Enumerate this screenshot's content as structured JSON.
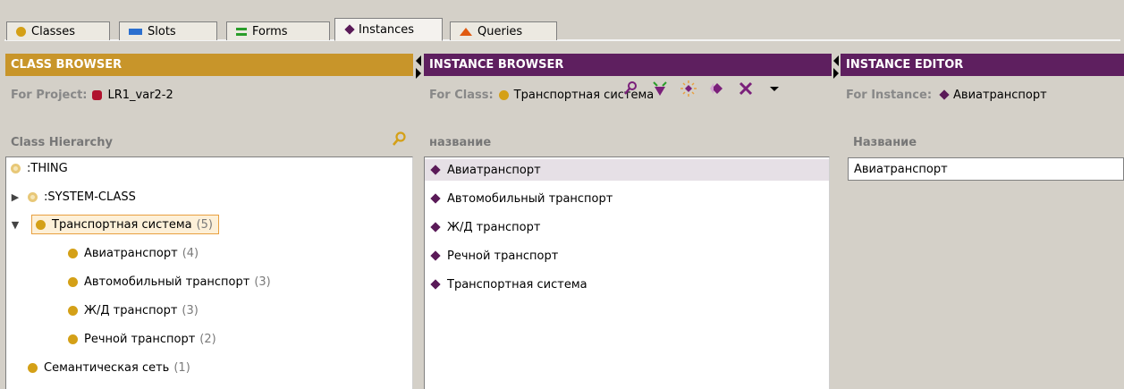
{
  "tabs": [
    {
      "label": "Classes",
      "icon": "class-dot-icon",
      "active": false
    },
    {
      "label": "Slots",
      "icon": "slot-bar-icon",
      "active": false
    },
    {
      "label": "Forms",
      "icon": "forms-icon",
      "active": false
    },
    {
      "label": "Instances",
      "icon": "instance-diamond-icon",
      "active": true
    },
    {
      "label": "Queries",
      "icon": "query-triangle-icon",
      "active": false
    }
  ],
  "class_browser": {
    "title": "CLASS BROWSER",
    "project_label": "For Project:",
    "project_name": "LR1_var2-2",
    "hierarchy_label": "Class Hierarchy",
    "tree": [
      {
        "label": ":THING",
        "count": "",
        "depth": 0,
        "toggle": "",
        "node": "ring"
      },
      {
        "label": ":SYSTEM-CLASS",
        "count": "",
        "depth": 0,
        "toggle": "collapsed",
        "node": "ring"
      },
      {
        "label": "Транспортная система",
        "count": "(5)",
        "depth": 0,
        "toggle": "expanded",
        "node": "gold",
        "selected": true
      },
      {
        "label": "Авиатранспорт",
        "count": "(4)",
        "depth": 1,
        "toggle": "",
        "node": "gold"
      },
      {
        "label": "Автомобильный транспорт",
        "count": "(3)",
        "depth": 1,
        "toggle": "",
        "node": "gold"
      },
      {
        "label": "Ж/Д транспорт",
        "count": "(3)",
        "depth": 1,
        "toggle": "",
        "node": "gold"
      },
      {
        "label": "Речной транспорт",
        "count": "(2)",
        "depth": 1,
        "toggle": "",
        "node": "gold"
      },
      {
        "label": "Семантическая сеть",
        "count": "(1)",
        "depth": 0,
        "toggle": "",
        "node": "gold"
      }
    ]
  },
  "instance_browser": {
    "title": "INSTANCE BROWSER",
    "class_label": "For Class:",
    "class_name": "Транспортная система",
    "column_label": "название",
    "instances": [
      {
        "label": "Авиатранспорт",
        "selected": true
      },
      {
        "label": "Автомобильный транспорт",
        "selected": false
      },
      {
        "label": "Ж/Д транспорт",
        "selected": false
      },
      {
        "label": "Речной транспорт",
        "selected": false
      },
      {
        "label": "Транспортная система",
        "selected": false
      }
    ]
  },
  "instance_editor": {
    "title": "INSTANCE EDITOR",
    "instance_label": "For Instance:",
    "instance_name": "Авиатранспорт",
    "field_label": "Название",
    "field_value": "Авиатранспорт"
  },
  "colors": {
    "class_header": "#c8952a",
    "instance_header": "#5e1f5f",
    "class_node": "#d4a017",
    "instance_diamond": "#5a1a58"
  }
}
